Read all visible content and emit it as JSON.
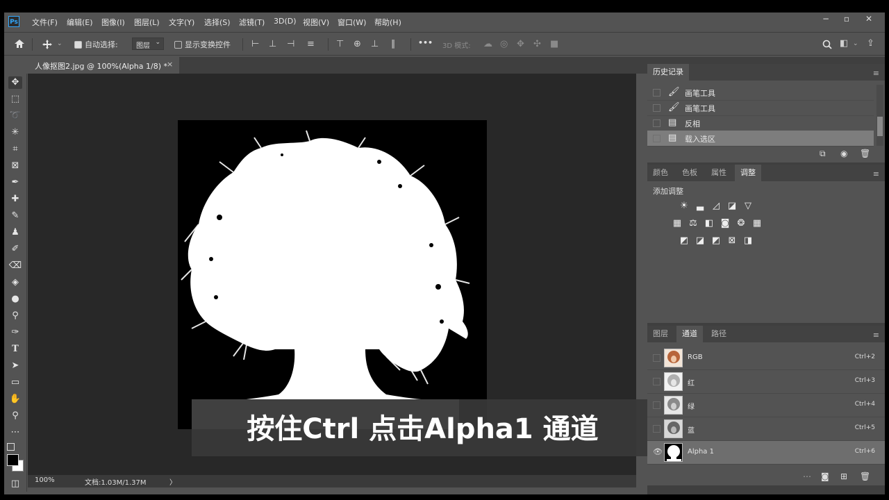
{
  "app": {
    "logo": "Ps"
  },
  "menu": [
    "文件(F)",
    "编辑(E)",
    "图像(I)",
    "图层(L)",
    "文字(Y)",
    "选择(S)",
    "滤镜(T)",
    "3D(D)",
    "视图(V)",
    "窗口(W)",
    "帮助(H)"
  ],
  "window_controls": {
    "minimize": "−",
    "restore": "▫",
    "close": "✕"
  },
  "options": {
    "auto_select_label": "自动选择:",
    "auto_select_target": "图层",
    "transform_label": "显示变换控件",
    "mode_3d_label": "3D 模式:",
    "more": "•••"
  },
  "document": {
    "tab_title": "人像抠图2.jpg @ 100%(Alpha 1/8) *",
    "tab_close": "×",
    "zoom": "100%",
    "doc_info": "文档:1.03M/1.37M",
    "info_arrow": "〉"
  },
  "caption": "按住Ctrl  点击Alpha1 通道",
  "history_panel": {
    "tab": "历史记录",
    "items": [
      {
        "icon": "brush-icon",
        "label": "画笔工具",
        "selected": false
      },
      {
        "icon": "brush-icon",
        "label": "画笔工具",
        "selected": false
      },
      {
        "icon": "document-icon",
        "label": "反相",
        "selected": false
      },
      {
        "icon": "document-icon",
        "label": "载入选区",
        "selected": true
      }
    ]
  },
  "adjust_panel": {
    "tabs": [
      "颜色",
      "色板",
      "属性",
      "调整"
    ],
    "active_tab": "调整",
    "heading": "添加调整"
  },
  "channels_panel": {
    "tabs": [
      "图层",
      "通道",
      "路径"
    ],
    "active_tab": "通道",
    "rows": [
      {
        "name": "RGB",
        "shortcut": "Ctrl+2",
        "selected": false
      },
      {
        "name": "红",
        "shortcut": "Ctrl+3",
        "selected": false
      },
      {
        "name": "绿",
        "shortcut": "Ctrl+4",
        "selected": false
      },
      {
        "name": "蓝",
        "shortcut": "Ctrl+5",
        "selected": false
      },
      {
        "name": "Alpha 1",
        "shortcut": "Ctrl+6",
        "selected": true
      }
    ]
  },
  "colors": {
    "accent": "#31a8ff",
    "panel": "#535353",
    "canvas": "#282828"
  }
}
